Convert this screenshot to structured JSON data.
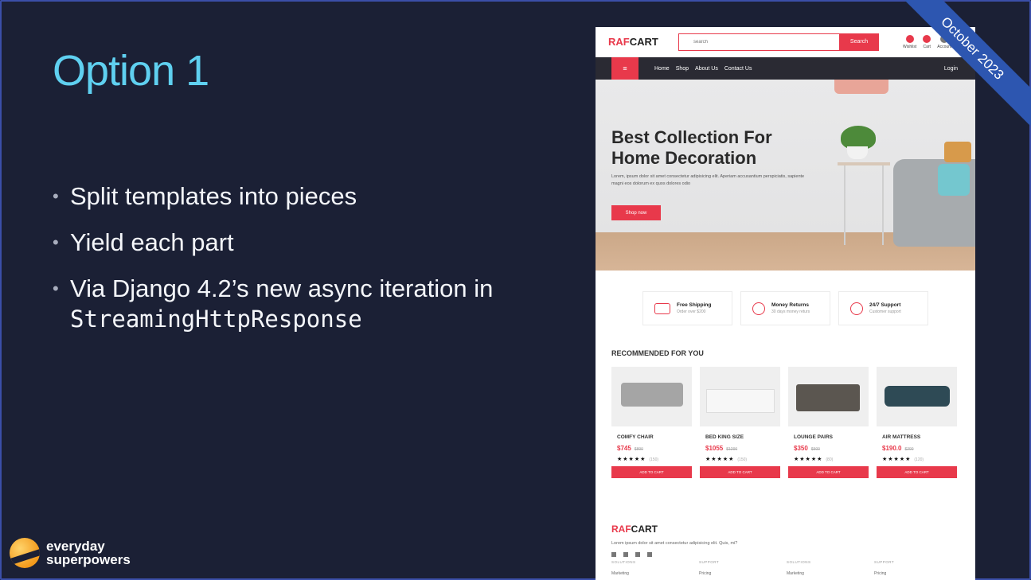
{
  "slide": {
    "title": "Option 1",
    "bullets": [
      "Split templates into pieces",
      "Yield each part",
      "Via Django 4.2’s new async iteration in"
    ],
    "code_text": "StreamingHttpResponse",
    "ribbon": "October 2023",
    "logo_line1": "everyday",
    "logo_line2": "superpowers"
  },
  "site": {
    "brand_a": "RAF",
    "brand_b": "CART",
    "search_placeholder": "search",
    "search_button": "Search",
    "header_icons": [
      "Wishlist",
      "Cart",
      "Account"
    ],
    "nav_links": [
      "Home",
      "Shop",
      "About Us",
      "Contact Us"
    ],
    "nav_login": "Login",
    "hero_title": "Best Collection For Home Decoration",
    "hero_text": "Lorem, ipsum dolor sit amet consectetur adipisicing elit. Aperiam accusantium perspiciatis, sapiente magni eos dolorum ex quos dolores odio",
    "hero_button": "Shop now",
    "features": [
      {
        "title": "Free Shipping",
        "sub": "Order over $200"
      },
      {
        "title": "Money Returns",
        "sub": "30 days money returs"
      },
      {
        "title": "24/7 Support",
        "sub": "Customer support"
      }
    ],
    "recommended_title": "RECOMMENDED FOR YOU",
    "products": [
      {
        "name": "COMFY CHAIR",
        "price": "$745",
        "old": "$890",
        "count": "(150)",
        "btn": "ADD TO CART"
      },
      {
        "name": "BED KING SIZE",
        "price": "$1055",
        "old": "$1290",
        "count": "(150)",
        "btn": "ADD TO CART"
      },
      {
        "name": "LOUNGE PAIRS",
        "price": "$350",
        "old": "$500",
        "count": "(80)",
        "btn": "ADD TO CART"
      },
      {
        "name": "AIR MATTRESS",
        "price": "$190.0",
        "old": "$290",
        "count": "(120)",
        "btn": "ADD TO CART"
      }
    ],
    "rating_stars": "★★★★★",
    "footer_brand_a": "RAF",
    "footer_brand_b": "CART",
    "footer_desc": "Lorem ipsum dolor sit amet consectetur adipisicing elit. Quis, mi?",
    "footer_cols": [
      "SOLUTIONS",
      "SUPPORT",
      "SOLUTIONS",
      "SUPPORT"
    ],
    "footer_links": [
      "Marketing",
      "Pricing",
      "Marketing",
      "Pricing"
    ]
  }
}
